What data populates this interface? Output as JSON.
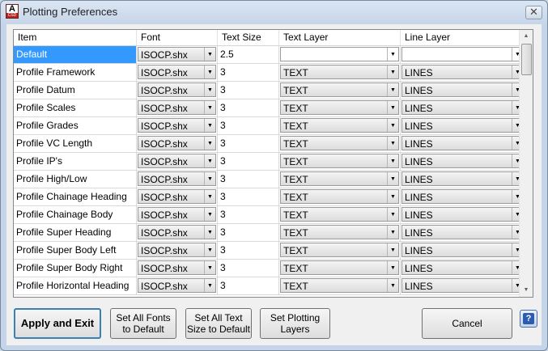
{
  "window": {
    "title": "Plotting Preferences",
    "close_glyph": "✕",
    "app_icon": "autocad-icon",
    "app_icon_letter": "A",
    "app_icon_sub": "CSD"
  },
  "grid": {
    "columns": [
      "Item",
      "Font",
      "Text Size",
      "Text Layer",
      "Line Layer"
    ],
    "rows": [
      {
        "item": "Default",
        "font": "ISOCP.shx",
        "size": "2.5",
        "text_layer": "",
        "line_layer": ""
      },
      {
        "item": "Profile Framework",
        "font": "ISOCP.shx",
        "size": "3",
        "text_layer": "TEXT",
        "line_layer": "LINES"
      },
      {
        "item": "Profile Datum",
        "font": "ISOCP.shx",
        "size": "3",
        "text_layer": "TEXT",
        "line_layer": "LINES"
      },
      {
        "item": "Profile Scales",
        "font": "ISOCP.shx",
        "size": "3",
        "text_layer": "TEXT",
        "line_layer": "LINES"
      },
      {
        "item": "Profile Grades",
        "font": "ISOCP.shx",
        "size": "3",
        "text_layer": "TEXT",
        "line_layer": "LINES"
      },
      {
        "item": "Profile VC Length",
        "font": "ISOCP.shx",
        "size": "3",
        "text_layer": "TEXT",
        "line_layer": "LINES"
      },
      {
        "item": "Profile IP's",
        "font": "ISOCP.shx",
        "size": "3",
        "text_layer": "TEXT",
        "line_layer": "LINES"
      },
      {
        "item": "Profile High/Low",
        "font": "ISOCP.shx",
        "size": "3",
        "text_layer": "TEXT",
        "line_layer": "LINES"
      },
      {
        "item": "Profile Chainage Heading",
        "font": "ISOCP.shx",
        "size": "3",
        "text_layer": "TEXT",
        "line_layer": "LINES"
      },
      {
        "item": "Profile Chainage Body",
        "font": "ISOCP.shx",
        "size": "3",
        "text_layer": "TEXT",
        "line_layer": "LINES"
      },
      {
        "item": "Profile Super Heading",
        "font": "ISOCP.shx",
        "size": "3",
        "text_layer": "TEXT",
        "line_layer": "LINES"
      },
      {
        "item": "Profile Super Body Left",
        "font": "ISOCP.shx",
        "size": "3",
        "text_layer": "TEXT",
        "line_layer": "LINES"
      },
      {
        "item": "Profile Super Body Right",
        "font": "ISOCP.shx",
        "size": "3",
        "text_layer": "TEXT",
        "line_layer": "LINES"
      },
      {
        "item": "Profile Horizontal Heading",
        "font": "ISOCP.shx",
        "size": "3",
        "text_layer": "TEXT",
        "line_layer": "LINES"
      }
    ],
    "selected_row": 0
  },
  "buttons": {
    "apply": "Apply and Exit",
    "fonts_default_1": "Set All Fonts",
    "fonts_default_2": "to Default",
    "size_default_1": "Set All Text",
    "size_default_2": "Size to Default",
    "layers_1": "Set Plotting",
    "layers_2": "Layers",
    "cancel": "Cancel",
    "help": "?"
  },
  "colors": {
    "selection": "#3399ff",
    "accent": "#3c7fb1"
  }
}
